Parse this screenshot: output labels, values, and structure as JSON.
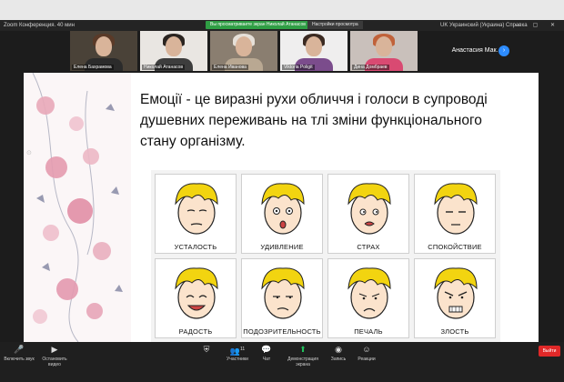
{
  "window": {
    "title": "Zoom Конференция. 40 мин",
    "banner": "Вы просматриваете экран Николай Атанасов",
    "view_options": "Настройки просмотра",
    "language": "UK Украинский (Украина)",
    "help": "Справка",
    "window_controls": "— ▢ ✕"
  },
  "participants": [
    {
      "name": "Елена Бахрамова"
    },
    {
      "name": "Николай Атанасов"
    },
    {
      "name": "Елена Иванова"
    },
    {
      "name": "Viktoria Poligit"
    },
    {
      "name": "Дина Домбраев"
    }
  ],
  "participant_no_video": {
    "name": "Анастасия  Мак..."
  },
  "next_page_icon": "chevron-right-icon",
  "slide": {
    "heading_lines": [
      "Емоції - це виразні рухи обличчя і голоси в супроводі",
      "душевних переживань на тлі зміни функціонального",
      "стану організму."
    ],
    "emotions": [
      "УСТАЛОСТЬ",
      "УДИВЛЕНИЕ",
      "СТРАХ",
      "СПОКОЙСТВИЕ",
      "РАДОСТЬ",
      "ПОДОЗРИТЕЛЬНОСТЬ",
      "ПЕЧАЛЬ",
      "ЗЛОСТЬ"
    ],
    "colors": {
      "hair": "#f2d410",
      "skin": "#fbe3cc",
      "outline": "#222222"
    }
  },
  "toolbar": {
    "mute": "Включить звук",
    "video": "Остановить видео",
    "security": "",
    "participants": "Участники",
    "participants_count": "11",
    "chat": "Чат",
    "share": "Демонстрация экрана",
    "record": "Запись",
    "reactions": "Реакции",
    "leave": "Выйти"
  },
  "colors": {
    "accent": "#2d8cff",
    "share": "#20c05c",
    "leave": "#e02828",
    "banner": "#2f9e44"
  }
}
